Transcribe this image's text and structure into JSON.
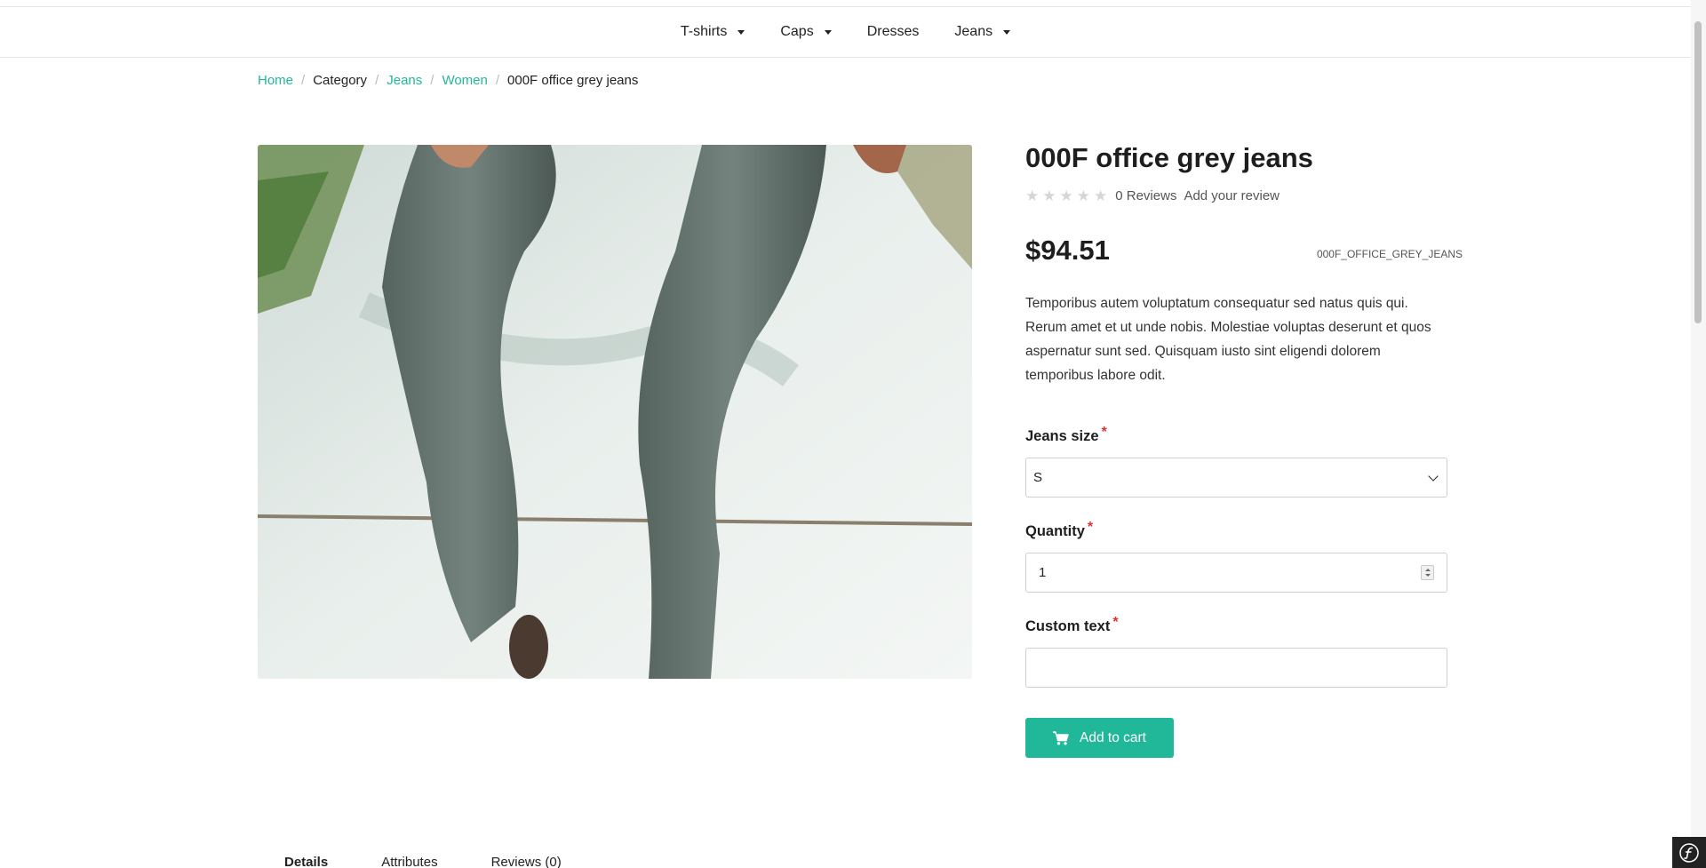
{
  "nav": {
    "items": [
      {
        "label": "T-shirts",
        "dropdown": true
      },
      {
        "label": "Caps",
        "dropdown": true
      },
      {
        "label": "Dresses",
        "dropdown": false
      },
      {
        "label": "Jeans",
        "dropdown": true
      }
    ]
  },
  "breadcrumb": {
    "home": "Home",
    "category": "Category",
    "jeans": "Jeans",
    "women": "Women",
    "current": "000F office grey jeans"
  },
  "product": {
    "title": "000F office grey jeans",
    "rating_stars": 0,
    "reviews_count": "0 Reviews",
    "add_review": "Add your review",
    "price": "$94.51",
    "sku": "000F_OFFICE_GREY_JEANS",
    "description": "Temporibus autem voluptatum consequatur sed natus quis qui. Rerum amet et ut unde nobis. Molestiae voluptas deserunt et quos aspernatur sunt sed. Quisquam iusto sint eligendi dolorem temporibus labore odit."
  },
  "form": {
    "size_label": "Jeans size",
    "size_value": "S",
    "quantity_label": "Quantity",
    "quantity_value": "1",
    "custom_text_label": "Custom text",
    "custom_text_value": "",
    "required_mark": "*",
    "add_to_cart": "Add to cart"
  },
  "tabs": [
    {
      "label": "Details",
      "active": true
    },
    {
      "label": "Attributes",
      "active": false
    },
    {
      "label": "Reviews (0)",
      "active": false
    }
  ],
  "colors": {
    "accent": "#21b799",
    "required": "#e03131"
  }
}
